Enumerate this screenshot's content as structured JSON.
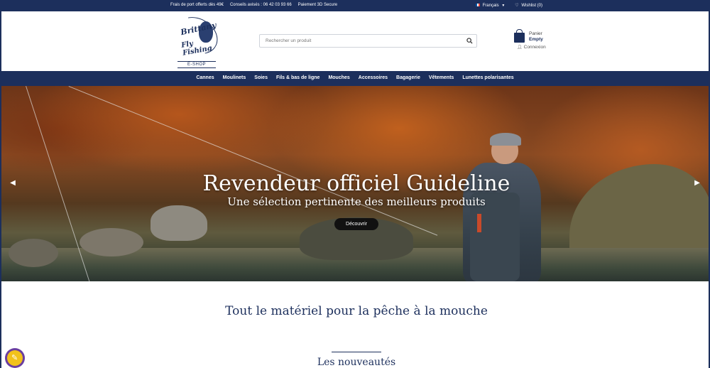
{
  "topbar": {
    "messages": [
      "Frais de port offerts dès 49€",
      "Conseils avisés : 06 42 03 93 66",
      "Paiement 3D Secure"
    ],
    "language": "Français",
    "wishlist": "Wishlist (0)"
  },
  "header": {
    "logo": {
      "line1": "Brittany",
      "line2": "Fly Fishing",
      "sub": "E-SHOP"
    },
    "search": {
      "placeholder": "Rechercher un produit"
    },
    "cart": {
      "label": "Panier",
      "value": "Empty"
    },
    "login": "Connexion"
  },
  "nav": {
    "items": [
      "Cannes",
      "Moulinets",
      "Soies",
      "Fils & bas de ligne",
      "Mouches",
      "Accessoires",
      "Bagagerie",
      "Vêtements",
      "Lunettes polarisantes"
    ]
  },
  "hero": {
    "title": "Revendeur officiel Guideline",
    "subtitle": "Une sélection pertinente des meilleurs produits",
    "cta": "Découvrir",
    "prev_icon": "chevron-left-icon",
    "next_icon": "chevron-right-icon"
  },
  "content": {
    "tagline": "Tout le matériel pour la pêche à la mouche",
    "section_title": "Les nouveautés"
  },
  "colors": {
    "primary": "#1c2f5c",
    "cta": "#111111",
    "badge": "#f2c21b"
  }
}
